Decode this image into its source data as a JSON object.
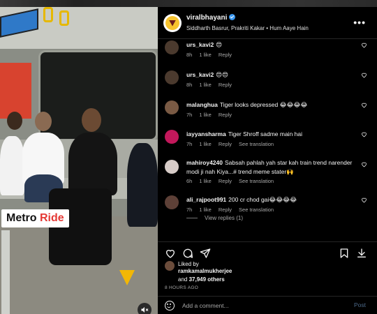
{
  "video": {
    "overlay_label_part1": "Metro ",
    "overlay_label_part2": "Ride",
    "accent_color": "#e53935",
    "watermark_icon": "brand-v-icon",
    "mute_icon": "speaker-muted-icon"
  },
  "header": {
    "username": "viralbhayani",
    "verified": true,
    "subtitle": "Siddharth Basrur, Prakriti Kakar • Hum Aaye Hain",
    "more_label": "•••"
  },
  "comments": [
    {
      "user": "urs_kavi2",
      "text": "😍",
      "time": "8h",
      "likes": "1 like",
      "reply": "Reply",
      "translate": "",
      "avatar_color": "#4b3a2e"
    },
    {
      "user": "urs_kavi2",
      "text": "😍😍",
      "time": "8h",
      "likes": "1 like",
      "reply": "Reply",
      "translate": "",
      "avatar_color": "#4b3a2e"
    },
    {
      "user": "malanghua",
      "text": "Tiger looks depressed 😂😂😂😂",
      "time": "7h",
      "likes": "1 like",
      "reply": "Reply",
      "translate": "",
      "avatar_color": "#7a5a44"
    },
    {
      "user": "iayyansharma",
      "text": "Tiger Shroff sadme main hai",
      "time": "7h",
      "likes": "1 like",
      "reply": "Reply",
      "translate": "See translation",
      "avatar_color": "#c2185b"
    },
    {
      "user": "mahiroy4240",
      "text": "Sabsah pahlah yah star kah train trend narender modi ji nah Kiya...# trend meme stater🙌",
      "time": "6h",
      "likes": "1 like",
      "reply": "Reply",
      "translate": "See translation",
      "avatar_color": "#d7ccc8"
    },
    {
      "user": "ali_rajpoot991",
      "text": "200 cr chod gai😂😂😂😂",
      "time": "7h",
      "likes": "1 like",
      "reply": "Reply",
      "translate": "See translation",
      "avatar_color": "#5d4037"
    }
  ],
  "view_replies": "View replies (1)",
  "actions": {
    "like_icon": "heart-icon",
    "comment_icon": "comment-icon",
    "share_icon": "paper-plane-icon",
    "save_icon": "bookmark-icon",
    "download_icon": "download-icon"
  },
  "likes": {
    "liked_by_label": "Liked by",
    "liked_by_user": "ramkamalmukherjee",
    "and_label": "and ",
    "count_text": "37,949 others",
    "date": "8 HOURS AGO"
  },
  "add_comment": {
    "placeholder": "Add a comment...",
    "post_label": "Post",
    "emoji_icon": "smiley-icon"
  }
}
